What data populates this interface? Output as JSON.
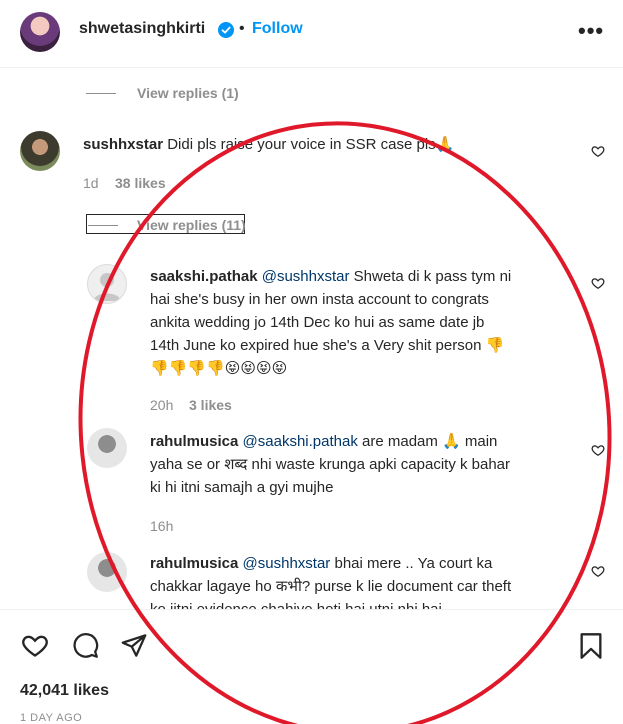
{
  "header": {
    "username": "shwetasinghkirti",
    "dot": "•",
    "follow_label": "Follow",
    "more": "•••"
  },
  "thread": {
    "view_replies_top": "View replies (1)",
    "comment1": {
      "username": "sushhxstar",
      "text": "Didi pls raise your voice in SSR case pls🙏",
      "time": "1d",
      "likes": "38 likes",
      "view_replies": "View replies (11)"
    },
    "reply1": {
      "username": "saakshi.pathak",
      "mention": "@sushhxstar",
      "line1": "Shweta di k pass tym ni",
      "line2": "hai she's busy in her own insta account to congrats",
      "line3": "ankita wedding jo 14th Dec ko hui as same date jb",
      "line4": "14th June ko expired hue she's a Very shit person 👎",
      "line5": "👎👎👎👎😝😝😝😝",
      "time": "20h",
      "likes": "3 likes"
    },
    "reply2": {
      "username": "rahulmusica",
      "mention": "@saakshi.pathak",
      "line1": "are madam 🙏 main",
      "line2": "yaha se or शब्द nhi waste krunga apki capacity k bahar",
      "line3": "ki hi itni samajh a gyi mujhe",
      "time": "16h"
    },
    "reply3": {
      "username": "rahulmusica",
      "mention": "@sushhxstar",
      "line1": "bhai mere .. Ya court ka",
      "line2": "chakkar lagaye ho कभी? purse k lie document car theft",
      "line3": "ko jitni evidence chahiye hoti hai utni nhi hai"
    }
  },
  "footer": {
    "likes": "42,041 likes",
    "time_ago": "1 DAY AGO"
  },
  "colors": {
    "accent": "#0095f6",
    "mention": "#00376b",
    "muted": "#8e8e8e",
    "annotation_circle": "#e0192a"
  }
}
